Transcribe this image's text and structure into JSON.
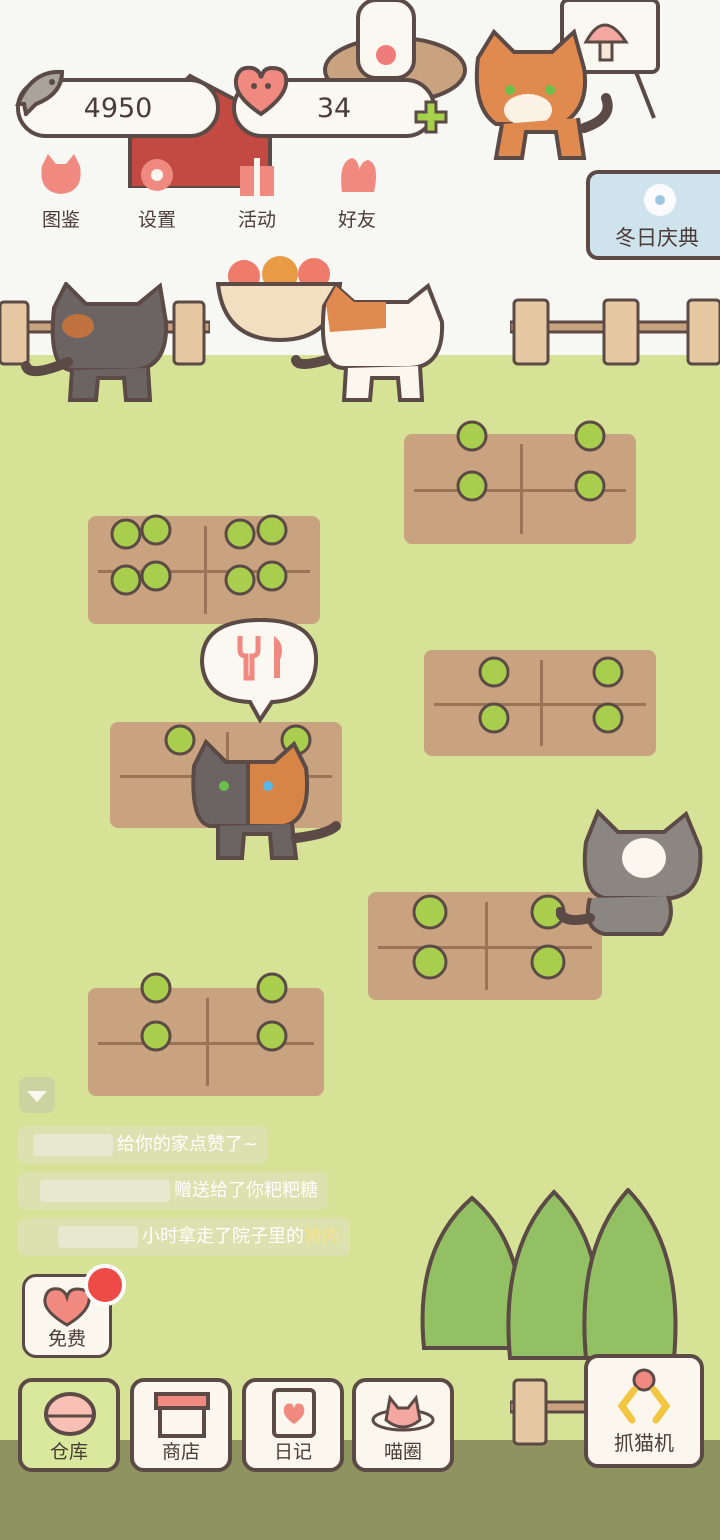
{
  "currencies": {
    "fish": "4950",
    "hearts": "34"
  },
  "top_menu": [
    {
      "label": "图鉴",
      "icon": "cat-book-icon"
    },
    {
      "label": "设置",
      "icon": "gear-icon"
    },
    {
      "label": "活动",
      "icon": "gift-icon"
    },
    {
      "label": "好友",
      "icon": "friends-icon"
    }
  ],
  "event": {
    "label": "冬日庆典",
    "icon": "flower-icon"
  },
  "messages": [
    {
      "text": "给你的家点赞了~"
    },
    {
      "text": "赠送给了你粑粑糖"
    },
    {
      "prefix": "小时拿走了院子里的",
      "highlight": "猪肉"
    }
  ],
  "free": {
    "label": "免费"
  },
  "bottom_nav": [
    {
      "label": "仓库",
      "icon": "warehouse-icon",
      "active": true
    },
    {
      "label": "商店",
      "icon": "shop-icon"
    },
    {
      "label": "日记",
      "icon": "diary-icon"
    },
    {
      "label": "喵圈",
      "icon": "planet-cat-icon"
    }
  ],
  "claw_machine": {
    "label": "抓猫机",
    "icon": "claw-icon"
  },
  "colors": {
    "outline": "#5b4a45",
    "grass": "#d6e295",
    "soil": "#c9a27f",
    "accent_green": "#9ccf3c",
    "badge_red": "#ef4b46"
  }
}
